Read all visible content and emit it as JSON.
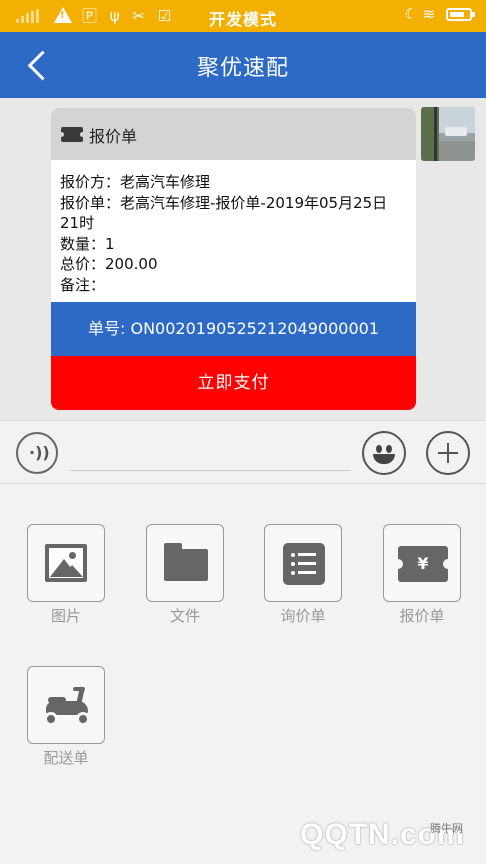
{
  "status_bar": {
    "title": "开发模式",
    "left_icons": "🄿 ψ ✂ ☑",
    "right_icons": "☾ ≋"
  },
  "nav": {
    "title": "聚优速配"
  },
  "quote_card": {
    "header_title": "报价单",
    "lines": [
      "报价方：老高汽车修理",
      "报价单：老高汽车修理-报价单-2019年05月25日 21时",
      "数量：1",
      "总价：200.00",
      "备注："
    ],
    "order_no": "单号: ON002019052521204900000​1",
    "pay_button": "立即支付"
  },
  "input_bar": {
    "text_value": "",
    "placeholder": ""
  },
  "tools": [
    {
      "label": "图片",
      "icon": "image-icon"
    },
    {
      "label": "文件",
      "icon": "folder-icon"
    },
    {
      "label": "询价单",
      "icon": "list-icon"
    },
    {
      "label": "报价单",
      "icon": "quote-ticket-icon"
    },
    {
      "label": "配送单",
      "icon": "scooter-icon"
    }
  ],
  "ticket_symbol": "¥",
  "watermark": {
    "brand": "QQTN.com",
    "small": "腾牛网"
  },
  "colors": {
    "status_bar": "#f3b000",
    "nav_bar": "#2d6ac6",
    "order_bar": "#2d6ac6",
    "pay_button": "#ff0000"
  }
}
